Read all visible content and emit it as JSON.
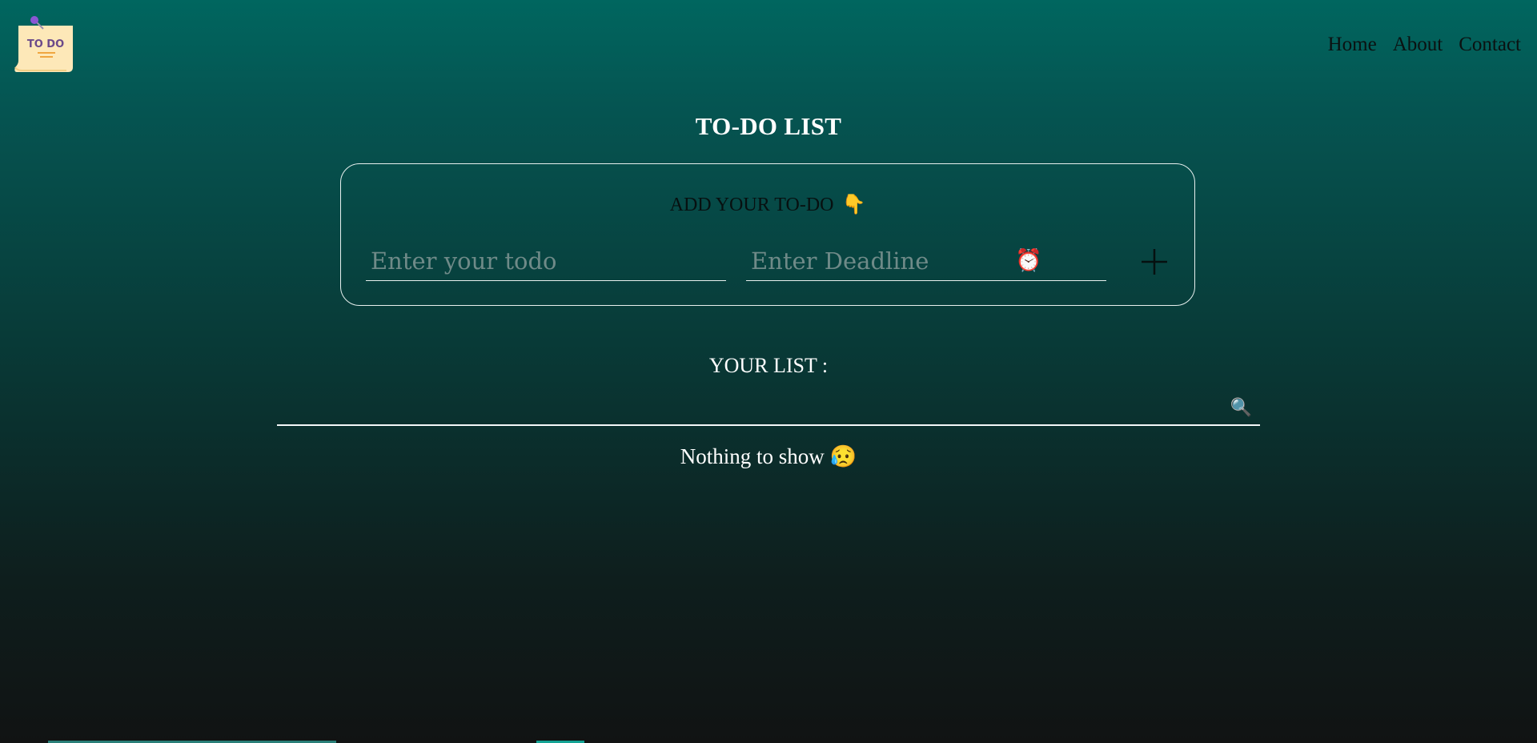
{
  "header": {
    "logo_text": "TO DO",
    "nav": [
      {
        "label": "Home"
      },
      {
        "label": "About"
      },
      {
        "label": "Contact"
      }
    ]
  },
  "main": {
    "title": "TO-DO LIST",
    "add_card": {
      "heading": "ADD YOUR TO-DO",
      "heading_emoji": "👇",
      "todo_placeholder": "Enter your todo",
      "deadline_placeholder": "Enter Deadline",
      "deadline_emoji": "⏰",
      "add_icon": "plus-icon"
    },
    "list": {
      "heading": "YOUR LIST :",
      "search_icon": "🔍",
      "empty_text": "Nothing to show",
      "empty_emoji": "😥"
    }
  },
  "colors": {
    "bg_top": "#00665f",
    "bg_bottom": "#111313",
    "border": "#e8f0ef",
    "nav_text": "#0b1111"
  }
}
